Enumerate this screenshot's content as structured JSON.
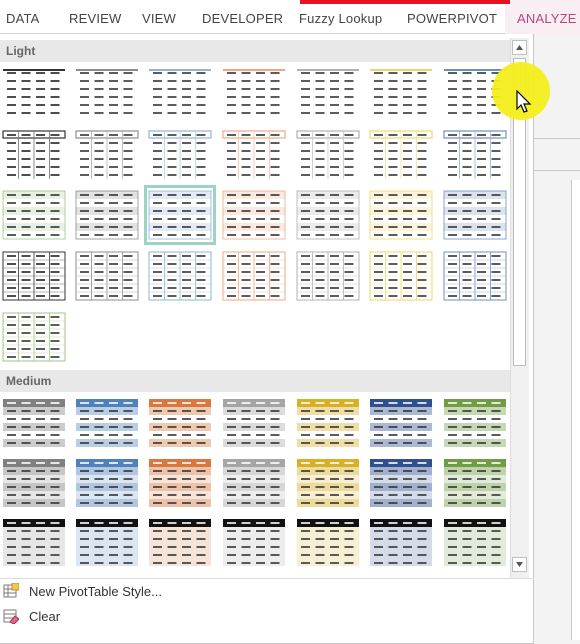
{
  "ribbon": {
    "tabs": [
      {
        "label": "DATA",
        "active": false
      },
      {
        "label": "REVIEW",
        "active": false
      },
      {
        "label": "VIEW",
        "active": false
      },
      {
        "label": "DEVELOPER",
        "active": false
      },
      {
        "label": "Fuzzy Lookup",
        "active": false
      },
      {
        "label": "POWERPIVOT",
        "active": false
      },
      {
        "label": "ANALYZE",
        "active": true
      }
    ],
    "accent_color": "#e81123",
    "active_tab_color": "#b4477e"
  },
  "gallery": {
    "sections": [
      {
        "label": "Light"
      },
      {
        "label": "Medium"
      }
    ],
    "light_palette": [
      "#333333",
      "#8c8c8c",
      "#8fb4d9",
      "#f0a782",
      "#b0b0b0",
      "#f2d56a",
      "#6f8fbf",
      "#9cc785"
    ],
    "medium_palette": [
      "#808080",
      "#4f81bd",
      "#d9773d",
      "#a5a5a5",
      "#d8b024",
      "#2f4f8f",
      "#6e9d43"
    ],
    "selected_style": "Light style row 3 column 3",
    "selected_outline_color": "#9cd3c2"
  },
  "scrollbar": {
    "up_icon": "triangle-up-icon",
    "down_icon": "triangle-down-icon"
  },
  "menu": {
    "new_style_label": "New PivotTable Style...",
    "new_style_icon": "new-style-icon",
    "clear_label": "Clear",
    "clear_icon": "eraser-icon"
  },
  "cursor": {
    "icon": "mouse-pointer-icon",
    "highlight_color": "#f4ee1c"
  }
}
